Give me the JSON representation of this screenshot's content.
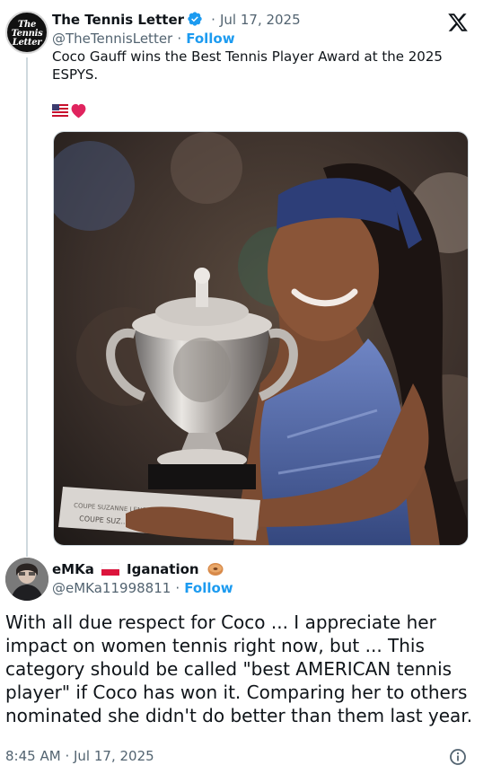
{
  "embed_brand": {
    "logo_icon": "x-logo-icon"
  },
  "quoted_tweet": {
    "author_name": "The Tennis Letter",
    "avatar_text_lines": [
      "The",
      "Tennis",
      "Letter"
    ],
    "separator": "·",
    "date": "Jul 17, 2025",
    "handle": "@TheTennisLetter",
    "follow_label": "Follow",
    "text": "Coco Gauff wins the Best Tennis Player Award at the 2025 ESPYS.",
    "emojis": [
      "us-flag-icon",
      "red-heart-icon"
    ],
    "media": {
      "description_icon": "photo-icon",
      "trophy_plaque_text": [
        "COUPE SUZANNE LENGLEN",
        "COUPE SUZ..."
      ]
    }
  },
  "reply": {
    "author_name": "eMKa",
    "author_suffix": "Iganation",
    "name_emojis": [
      "poland-flag-icon",
      "bagel-icon"
    ],
    "handle": "@eMKa11998811",
    "separator": "·",
    "follow_label": "Follow",
    "text": "With all due respect for Coco ... I appreciate her impact on women tennis right now, but ... This category should be called \"best AMERICAN tennis player\" if Coco has won it. Comparing her to others nominated she didn't do better than them last year.",
    "time": "8:45 AM",
    "date": "Jul 17, 2025",
    "info_icon": "info-icon"
  },
  "colors": {
    "link_blue": "#1d9bf0",
    "muted_gray": "#536471",
    "text": "#0f1419",
    "thread_line": "#cfd9de",
    "verified_blue": "#1d9bf0"
  }
}
